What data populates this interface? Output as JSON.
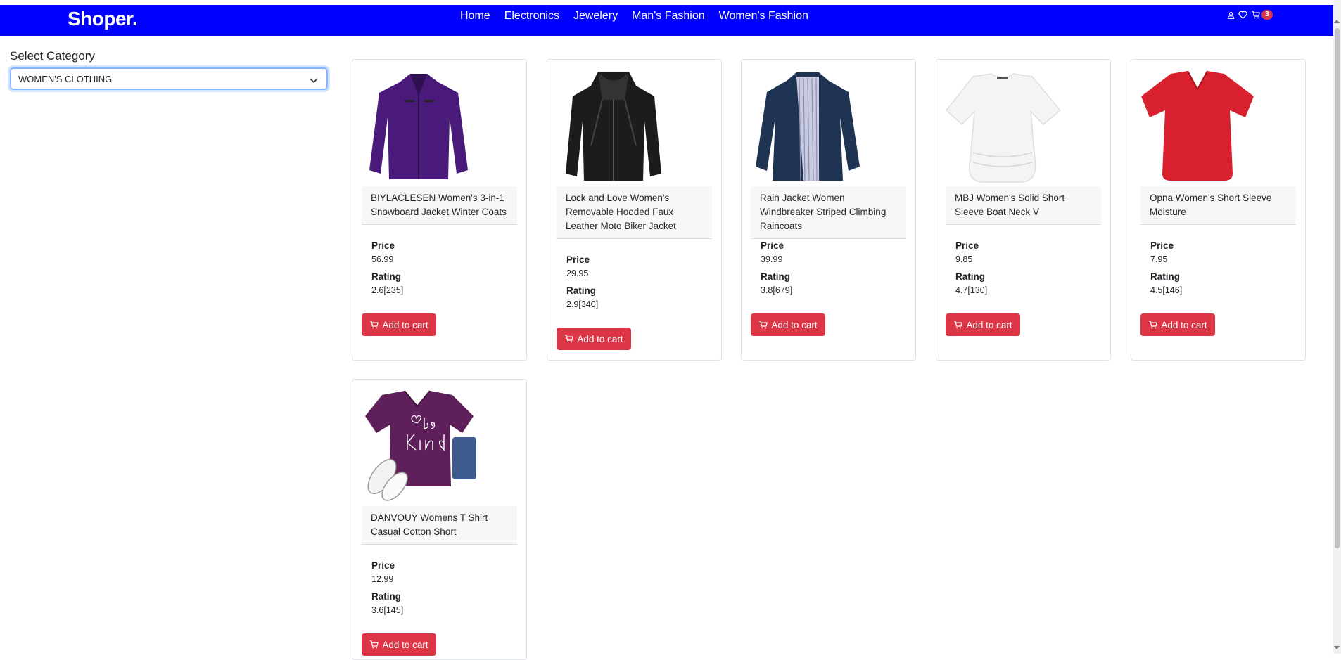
{
  "brand": "Shoper.",
  "nav": {
    "links": [
      "Home",
      "Electronics",
      "Jewelery",
      "Man's Fashion",
      "Women's Fashion"
    ],
    "cart_count": "3",
    "icons": [
      "user-icon",
      "heart-icon",
      "cart-icon"
    ]
  },
  "sidebar": {
    "label": "Select Category",
    "selected": "WOMEN'S CLOTHING"
  },
  "labels": {
    "price": "Price",
    "rating": "Rating",
    "add_to_cart": "Add to cart"
  },
  "products": [
    {
      "title": "BIYLACLESEN Women's 3-in-1 Snowboard Jacket Winter Coats",
      "price": "56.99",
      "rating": "2.6[235]",
      "image": "purple-jacket",
      "color": "#4a1a7a"
    },
    {
      "title": "Lock and Love Women's Removable Hooded Faux Leather Moto Biker Jacket",
      "price": "29.95",
      "rating": "2.9[340]",
      "image": "black-leather-jacket",
      "color": "#1c1c1c"
    },
    {
      "title": "Rain Jacket Women Windbreaker Striped Climbing Raincoats",
      "price": "39.99",
      "rating": "3.8[679]",
      "image": "navy-raincoat",
      "color": "#1f3352"
    },
    {
      "title": "MBJ Women's Solid Short Sleeve Boat Neck V",
      "price": "9.85",
      "rating": "4.7[130]",
      "image": "white-tshirt",
      "color": "#f4f4f4"
    },
    {
      "title": "Opna Women's Short Sleeve Moisture",
      "price": "7.95",
      "rating": "4.5[146]",
      "image": "red-tshirt",
      "color": "#d8202e"
    },
    {
      "title": "DANVOUY Womens T Shirt Casual Cotton Short",
      "price": "12.99",
      "rating": "3.6[145]",
      "image": "purple-be-kind-tshirt",
      "color": "#5e1f5a"
    }
  ],
  "colors": {
    "navbar": "#0000ff",
    "button": "#dc3545",
    "badge": "#dc3545",
    "select_focus": "#86b7fe"
  }
}
